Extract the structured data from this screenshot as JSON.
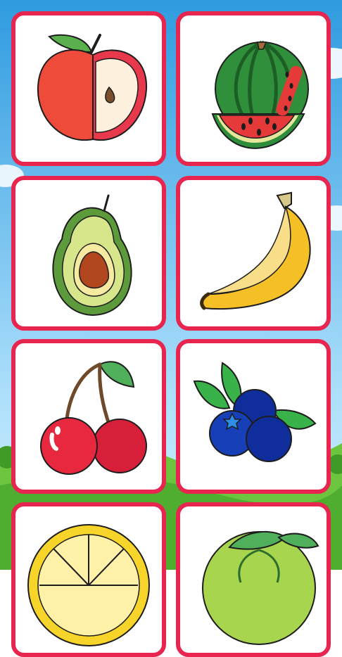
{
  "screen": "fruit-coloring-picker",
  "colors": {
    "card_border": "#e8254f",
    "card_background": "#ffffff",
    "sky_top": "#3aa7e8",
    "sky_bottom": "#bfe8ff",
    "grass": "#5cb837"
  },
  "cards": [
    {
      "fruit": "apple-icon"
    },
    {
      "fruit": "watermelon-icon"
    },
    {
      "fruit": "avocado-icon"
    },
    {
      "fruit": "banana-icon"
    },
    {
      "fruit": "cherry-icon"
    },
    {
      "fruit": "blueberry-icon"
    },
    {
      "fruit": "lemon-icon"
    },
    {
      "fruit": "green-fruit-icon"
    }
  ]
}
